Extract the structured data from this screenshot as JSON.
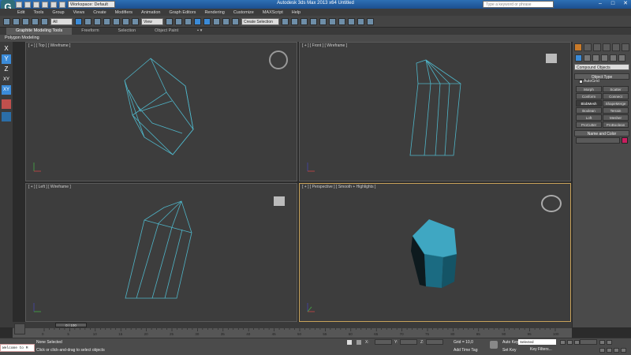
{
  "window": {
    "title": "Autodesk 3ds Max 2013 x64     Untitled",
    "workspace": "Workspace: Default",
    "search_placeholder": "Type a keyword or phrase"
  },
  "menu": [
    "Edit",
    "Tools",
    "Group",
    "Views",
    "Create",
    "Modifiers",
    "Animation",
    "Graph Editors",
    "Rendering",
    "Customize",
    "MAXScript",
    "Help"
  ],
  "toolbar": {
    "selection_filter": "All",
    "ref_coord": "View",
    "named_selection": "Create Selection Se"
  },
  "ribbon": {
    "tabs": [
      "Graphite Modeling Tools",
      "Freeform",
      "Selection",
      "Object Paint"
    ],
    "panel_label": "Polygon Modeling"
  },
  "left_toolbar": [
    "X",
    "Y",
    "Z",
    "XY",
    "XY"
  ],
  "viewports": {
    "top": "[ + ] [ Top ] [ Wireframe ]",
    "front": "[ + ] [ Front ] [ Wireframe ]",
    "left": "[ + ] [ Left ] [ Wireframe ]",
    "perspective": "[ + ] [ Perspective ] [ Smooth + Highlights ]"
  },
  "command_panel": {
    "category": "Compound Objects",
    "object_type_title": "Object Type",
    "autogrid": "AutoGrid",
    "buttons": [
      "Morph",
      "Scatter",
      "Conform",
      "Connect",
      "BlobMesh",
      "ShapeMerge",
      "Boolean",
      "Terrain",
      "Loft",
      "Mesher",
      "ProCutter",
      "ProBoolean"
    ],
    "name_color_title": "Name and Color",
    "colors": {
      "object_color": "#c81e5f"
    }
  },
  "timeline": {
    "slider": "0 / 100",
    "ticks": [
      "0",
      "5",
      "10",
      "15",
      "20",
      "25",
      "30",
      "35",
      "40",
      "45",
      "50",
      "55",
      "60",
      "65",
      "70",
      "75",
      "80",
      "85",
      "90",
      "95",
      "100"
    ]
  },
  "status": {
    "listener": "Welcome to M",
    "selection": "None Selected",
    "prompt": "Click or click-and-drag to select objects",
    "grid": "Grid = 10,0",
    "add_time_tag": "Add Time Tag",
    "auto_key": "Auto Key",
    "set_key": "Set Key",
    "key_mode": "Selected",
    "key_filters": "Key Filters..."
  }
}
